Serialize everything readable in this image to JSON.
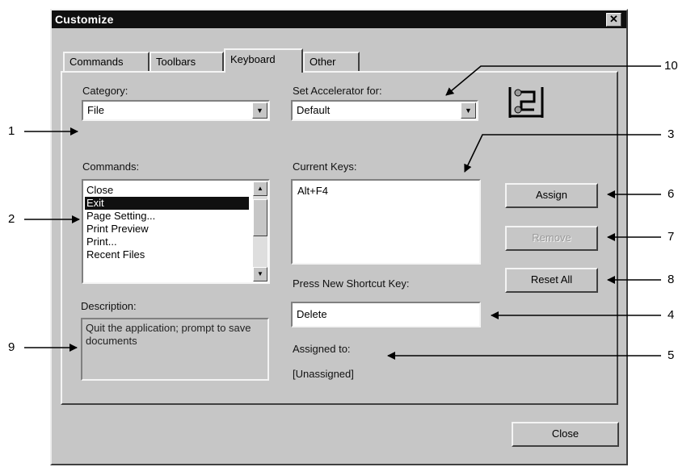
{
  "window": {
    "title": "Customize",
    "close_glyph": "✕"
  },
  "tabs": [
    {
      "label": "Commands"
    },
    {
      "label": "Toolbars"
    },
    {
      "label": "Keyboard"
    },
    {
      "label": "Other"
    }
  ],
  "category": {
    "label": "Category:",
    "value": "File"
  },
  "commands": {
    "label": "Commands:",
    "items": [
      "Close",
      "Exit",
      "Page Setting...",
      "Print Preview",
      "Print...",
      "Recent Files"
    ],
    "selected_index": 1
  },
  "description": {
    "label": "Description:",
    "text": "Quit the application; prompt to save documents"
  },
  "accelerator": {
    "label": "Set Accelerator for:",
    "value": "Default"
  },
  "current_keys": {
    "label": "Current Keys:",
    "items": [
      "Alt+F4"
    ]
  },
  "shortcut": {
    "label": "Press New Shortcut Key:",
    "value": "Delete"
  },
  "assigned": {
    "label": "Assigned to:",
    "value": "[Unassigned]"
  },
  "buttons": {
    "assign": "Assign",
    "remove": "Remove",
    "reset_all": "Reset All",
    "close": "Close"
  },
  "callouts": [
    "1",
    "2",
    "3",
    "4",
    "5",
    "6",
    "7",
    "8",
    "9",
    "10"
  ],
  "icons": {
    "window_icon": "keyboard-accelerator-icon",
    "dropdown": "chevron-down-icon"
  }
}
